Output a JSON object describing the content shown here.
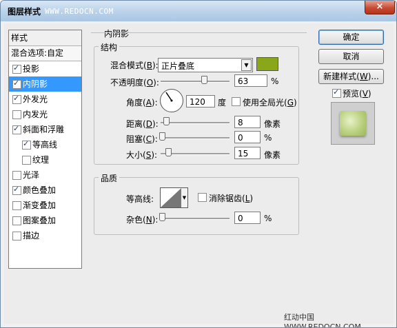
{
  "window": {
    "title": "图层样式",
    "watermark": "WWW.REDOCN.COM",
    "close": "×"
  },
  "styles_panel": {
    "header": "样式",
    "blend_options": "混合选项:自定",
    "items": [
      {
        "label": "投影",
        "checked": true
      },
      {
        "label": "内阴影",
        "checked": true,
        "selected": true
      },
      {
        "label": "外发光",
        "checked": true
      },
      {
        "label": "内发光",
        "checked": false
      },
      {
        "label": "斜面和浮雕",
        "checked": true
      },
      {
        "label": "等高线",
        "checked": true,
        "indent": true
      },
      {
        "label": "纹理",
        "checked": false,
        "indent": true
      },
      {
        "label": "光泽",
        "checked": false
      },
      {
        "label": "颜色叠加",
        "checked": true
      },
      {
        "label": "渐变叠加",
        "checked": false
      },
      {
        "label": "图案叠加",
        "checked": false
      },
      {
        "label": "描边",
        "checked": false
      }
    ]
  },
  "inner_shadow": {
    "title": "内阴影",
    "structure": {
      "title": "结构",
      "blend_mode_label": "混合模式",
      "blend_mode_key": "B",
      "blend_mode_value": "正片叠底",
      "blend_color": "#8aa619",
      "opacity_label": "不透明度",
      "opacity_key": "O",
      "opacity_value": "63",
      "opacity_unit": "%",
      "opacity_fraction": 0.63,
      "angle_label": "角度",
      "angle_key": "A",
      "angle_value": "120",
      "angle_unit": "度",
      "use_global_light_label": "使用全局光",
      "use_global_light_key": "G",
      "use_global_light_checked": false,
      "distance_label": "距离",
      "distance_key": "D",
      "distance_value": "8",
      "distance_unit": "像素",
      "choke_label": "阻塞",
      "choke_key": "C",
      "choke_value": "0",
      "choke_unit": "%",
      "size_label": "大小",
      "size_key": "S",
      "size_value": "15",
      "size_unit": "像素"
    },
    "quality": {
      "title": "品质",
      "contour_label": "等高线",
      "anti_alias_label": "消除锯齿",
      "anti_alias_key": "L",
      "anti_alias_checked": false,
      "noise_label": "杂色",
      "noise_key": "N",
      "noise_value": "0",
      "noise_unit": "%"
    }
  },
  "buttons": {
    "ok": "确定",
    "cancel": "取消",
    "new_style_prefix": "新建样式(",
    "new_style_key": "W",
    "new_style_suffix": ")...",
    "preview_label": "预览",
    "preview_key": "V",
    "preview_checked": true
  },
  "footer_watermark": "红动中国 WWW.REDOCN.COM"
}
